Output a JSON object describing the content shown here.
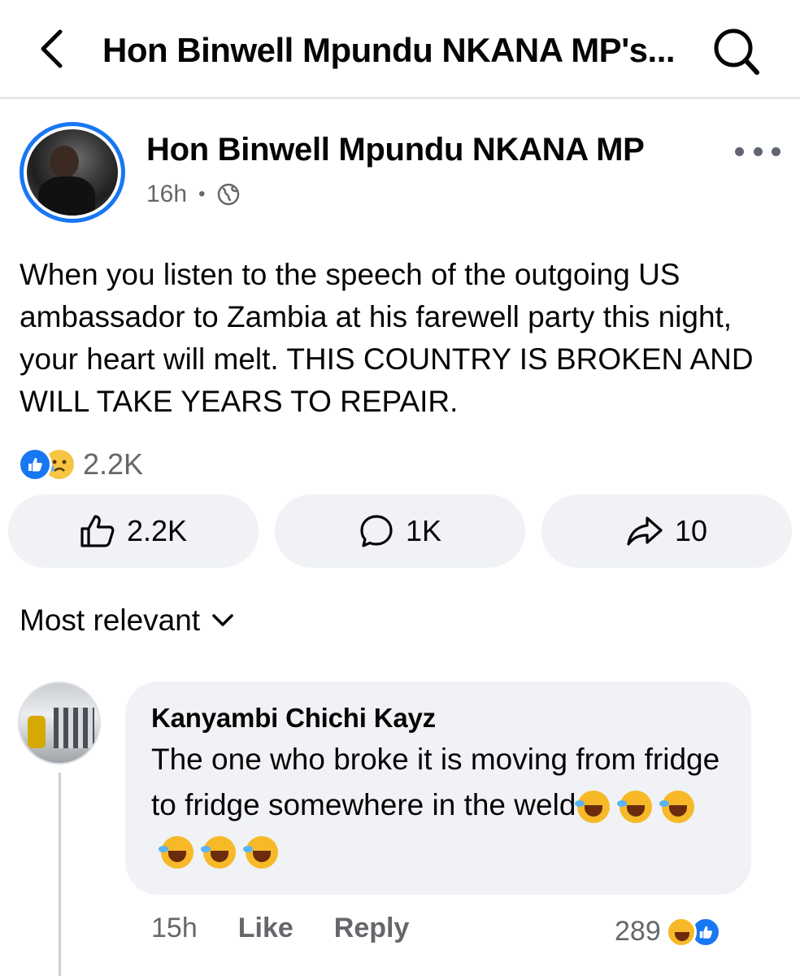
{
  "header": {
    "title": "Hon Binwell Mpundu NKANA MP's..."
  },
  "post": {
    "author": "Hon Binwell Mpundu NKANA MP",
    "time": "16h",
    "separator": "•",
    "audience_icon": "globe-icon",
    "text": "When you listen to the speech of the outgoing US ambassador to Zambia at his farewell party this night, your heart will melt. THIS COUNTRY IS BROKEN AND WILL TAKE YEARS TO REPAIR.",
    "reaction_icons": [
      "like",
      "sad"
    ],
    "reaction_total": "2.2K",
    "actions": {
      "like_count": "2.2K",
      "comment_count": "1K",
      "share_count": "10"
    }
  },
  "comments_sort": "Most relevant",
  "comment": {
    "author": "Kanyambi Chichi Kayz",
    "text": "The one who broke it is moving from fridge to fridge somewhere in the weld",
    "trailing_emoji": "rolling-on-floor-laughing",
    "trailing_emoji_count": 6,
    "time": "15h",
    "like_label": "Like",
    "reply_label": "Reply",
    "reaction_count": "289",
    "reaction_icons": [
      "haha",
      "like"
    ]
  },
  "colors": {
    "brand_blue": "#1877f2",
    "secondary_text": "#65676b",
    "bubble_bg": "#f0f2f5"
  }
}
